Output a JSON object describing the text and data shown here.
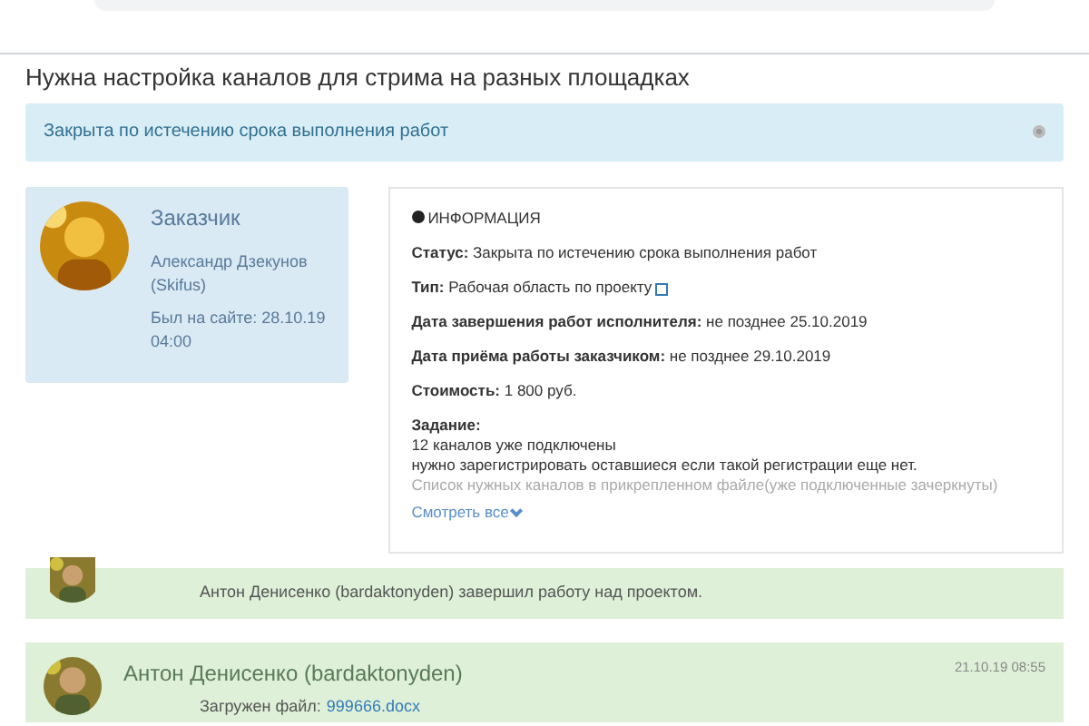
{
  "title": "Нужна настройка каналов для стрима на разных площадках",
  "alert": {
    "text": "Закрыта по истечению срока выполнения работ"
  },
  "customer": {
    "heading": "Заказчик",
    "name": "Александр Дзекунов (Skifus)",
    "last_seen": "Был на сайте: 28.10.19 04:00"
  },
  "info": {
    "heading": "ИНФОРМАЦИЯ",
    "fields": [
      {
        "label": "Статус:",
        "value": "Закрыта по истечению срока выполнения работ",
        "link_icon": false
      },
      {
        "label": "Тип:",
        "value": "Рабочая область по проекту",
        "link_icon": true
      },
      {
        "label": "Дата завершения работ исполнителя:",
        "value": "не позднее 25.10.2019",
        "link_icon": false
      },
      {
        "label": "Дата приёма работы заказчиком:",
        "value": "не позднее 29.10.2019",
        "link_icon": false
      },
      {
        "label": "Стоимость:",
        "value": "1 800 руб.",
        "link_icon": false
      }
    ],
    "task_label": "Задание:",
    "task_lines": [
      "12 каналов уже подключены",
      "нужно зарегистрировать оставшиеся если такой регистрации еще нет.",
      "Список нужных каналов в прикрепленном файле(уже подключенные зачеркнуты)"
    ],
    "more": "Смотреть все"
  },
  "messages": [
    {
      "kind": "event",
      "text": "Антон Денисенко (bardaktonyden) завершил работу над проектом."
    },
    {
      "kind": "file",
      "author": "Антон Денисенко (bardaktonyden)",
      "time": "21.10.19 08:55",
      "label": "Загружен файл:",
      "file": "999666.docx"
    }
  ]
}
